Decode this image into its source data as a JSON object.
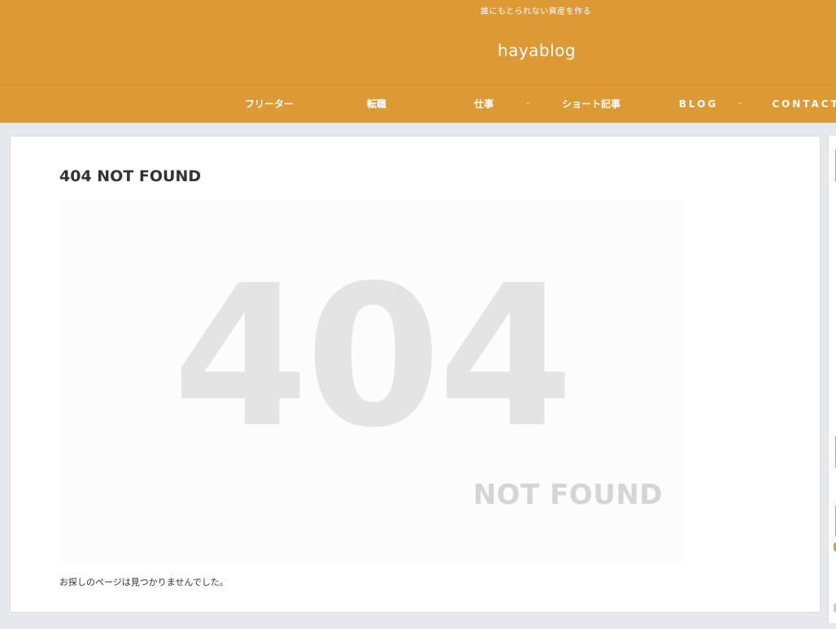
{
  "header": {
    "tagline": "誰にもとられない資産を作る",
    "site_title": "hayablog"
  },
  "nav": {
    "items": [
      {
        "label": "フリーター",
        "has_dropdown": false
      },
      {
        "label": "転職",
        "has_dropdown": false
      },
      {
        "label": "仕事",
        "has_dropdown": true
      },
      {
        "label": "ショート記事",
        "has_dropdown": false
      },
      {
        "label": "BLOG",
        "has_dropdown": true
      },
      {
        "label": "CONTACT",
        "has_dropdown": false
      }
    ],
    "dropdown_glyph": "⌄"
  },
  "main": {
    "title": "404 NOT FOUND",
    "image_big_text": "404",
    "image_small_text": "NOT FOUND",
    "message": "お探しのページは見つかりませんでした。"
  },
  "colors": {
    "accent": "#dd9933",
    "background": "#e5e9ee",
    "card": "#ffffff",
    "text": "#333333"
  }
}
